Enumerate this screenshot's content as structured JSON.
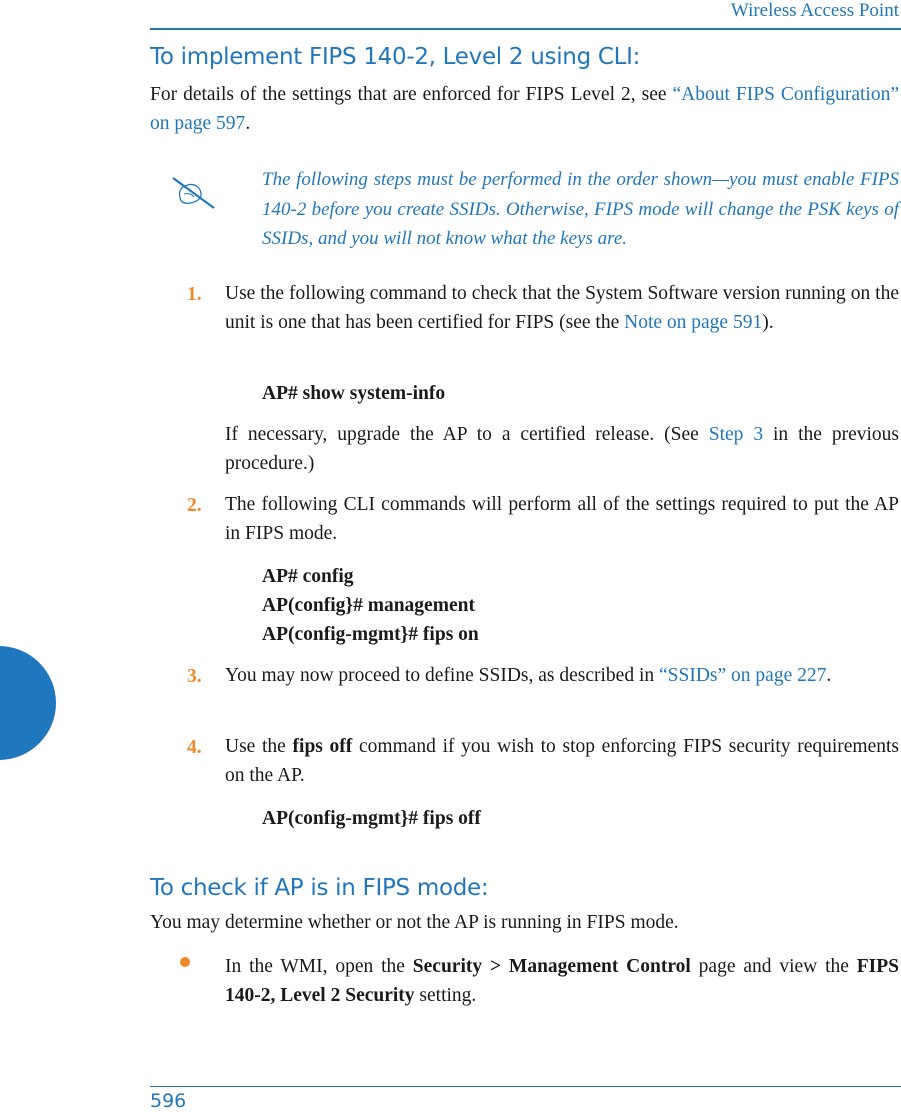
{
  "header": {
    "title": "Wireless Access Point"
  },
  "footer": {
    "page_number": "596"
  },
  "section1": {
    "heading": "To implement FIPS 140-2, Level 2 using CLI:",
    "intro_before": "For details of the settings that are enforced for FIPS Level 2, see ",
    "intro_link": "“About FIPS Configuration” on page 597",
    "intro_after": ".",
    "note": {
      "icon": "pencil-hand-icon",
      "text": "The following steps must be performed in the order shown—you must enable FIPS 140-2 before you create SSIDs. Otherwise, FIPS mode will change the PSK keys of SSIDs, and you will not know what the keys are."
    },
    "steps": [
      {
        "number": "1.",
        "text_before": "Use the following command to check that the System Software version running on the unit is one that has been certified for FIPS (see the ",
        "link": "Note on page 591",
        "text_after": ").",
        "commands": [
          "AP# show system-info"
        ],
        "followup_before": "If necessary, upgrade the AP to a certified release. (See ",
        "followup_link": "Step 3",
        "followup_after": " in the previous procedure.)"
      },
      {
        "number": "2.",
        "text": "The following CLI commands will perform all of the settings required to put the AP in FIPS mode.",
        "commands": [
          "AP# config",
          "AP(config}# management",
          "AP(config-mgmt}# fips on"
        ]
      },
      {
        "number": "3.",
        "text_before": "You may now proceed to define SSIDs, as described in ",
        "link": "“SSIDs” on page 227",
        "text_after": "."
      },
      {
        "number": "4.",
        "text_before": "Use the ",
        "bold": "fips off",
        "text_after": " command if you wish to stop enforcing FIPS security requirements on the AP.",
        "commands": [
          "AP(config-mgmt}# fips off"
        ]
      }
    ]
  },
  "section2": {
    "heading": "To check if AP is in FIPS mode:",
    "intro": "You may determine whether or not the AP is running in FIPS mode.",
    "bullet": {
      "text_before": "In the WMI, open the ",
      "bold1": "Security > Management Control",
      "text_middle": " page and view the ",
      "bold2": "FIPS 140-2, Level 2 Security",
      "text_after": " setting."
    }
  },
  "colors": {
    "accent_blue": "#2277bb",
    "step_orange": "#f0892a",
    "side_tab": "#1f77bd"
  }
}
